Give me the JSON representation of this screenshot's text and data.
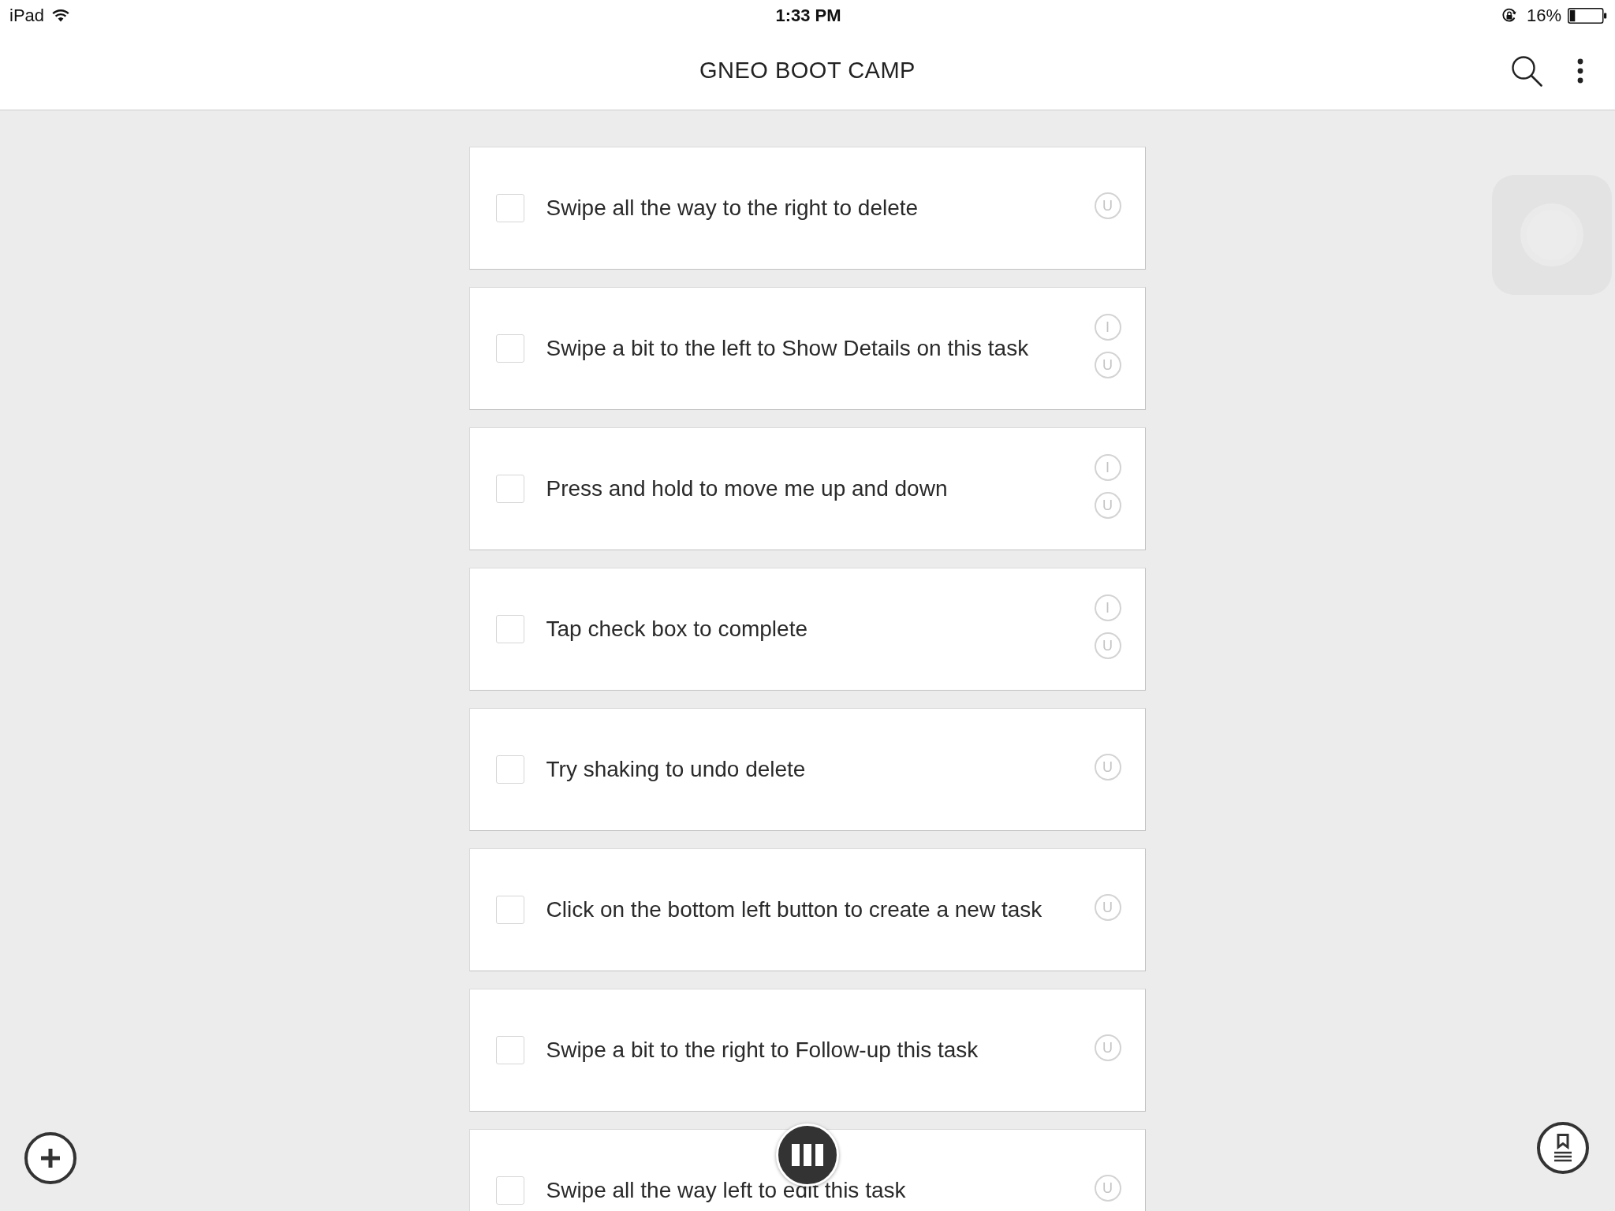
{
  "status_bar": {
    "device": "iPad",
    "time": "1:33 PM",
    "battery": "16%"
  },
  "header": {
    "title": "GNEO BOOT CAMP"
  },
  "tasks": [
    {
      "text": "Swipe all the way to the right to delete",
      "checked": false,
      "badges": [
        "U"
      ]
    },
    {
      "text": "Swipe a bit to the left to Show Details on this task",
      "checked": false,
      "badges": [
        "I",
        "U"
      ]
    },
    {
      "text": "Press and hold to move me up and down",
      "checked": false,
      "badges": [
        "I",
        "U"
      ]
    },
    {
      "text": "Tap check box to complete",
      "checked": false,
      "badges": [
        "I",
        "U"
      ]
    },
    {
      "text": "Try shaking to undo delete",
      "checked": false,
      "badges": [
        "U"
      ]
    },
    {
      "text": "Click on the bottom left button to create a new task",
      "checked": false,
      "badges": [
        "U"
      ]
    },
    {
      "text": "Swipe a bit to the right to Follow-up this task",
      "checked": false,
      "badges": [
        "U"
      ]
    },
    {
      "text": "Swipe all the way left to edit this task",
      "checked": false,
      "badges": [
        "U"
      ]
    }
  ]
}
